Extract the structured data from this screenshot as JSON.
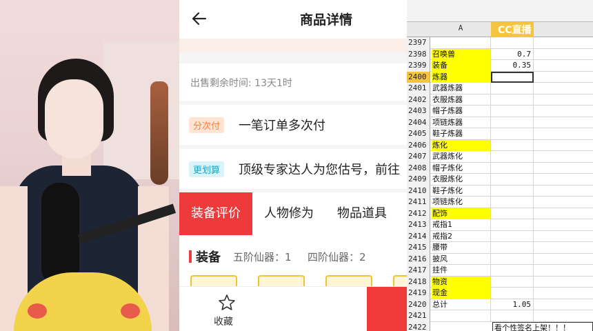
{
  "header": {
    "title": "商品详情"
  },
  "timer": {
    "text": "出售剩余时间: 13天1时"
  },
  "installment": {
    "tag": "分次付",
    "text": "一笔订单多次付"
  },
  "estimate": {
    "tag": "更划算",
    "text": "顶级专家达人为您估号，前往"
  },
  "tabs": [
    {
      "label": "装备评价",
      "active": true
    },
    {
      "label": "人物修为",
      "active": false
    },
    {
      "label": "物品道具",
      "active": false
    }
  ],
  "equipment": {
    "title": "装备",
    "stat1": "五阶仙器：1",
    "stat2": "四阶仙器：2"
  },
  "footer": {
    "favorite_label": "收藏"
  },
  "sheet": {
    "col_a_header": "A",
    "watermark": "CC直播",
    "rows": [
      {
        "num": "2397",
        "a": "",
        "b": ""
      },
      {
        "num": "2398",
        "a": "召唤兽",
        "b": "0.7"
      },
      {
        "num": "2399",
        "a": "装备",
        "b": "0.35"
      },
      {
        "num": "2400",
        "a": "炼器",
        "b": ""
      },
      {
        "num": "2401",
        "a": "武器炼器",
        "b": ""
      },
      {
        "num": "2402",
        "a": "衣服炼器",
        "b": ""
      },
      {
        "num": "2403",
        "a": "帽子炼器",
        "b": ""
      },
      {
        "num": "2404",
        "a": "项链炼器",
        "b": ""
      },
      {
        "num": "2405",
        "a": "鞋子炼器",
        "b": ""
      },
      {
        "num": "2406",
        "a": "炼化",
        "b": ""
      },
      {
        "num": "2407",
        "a": "武器炼化",
        "b": ""
      },
      {
        "num": "2408",
        "a": "帽子炼化",
        "b": ""
      },
      {
        "num": "2409",
        "a": "衣服炼化",
        "b": ""
      },
      {
        "num": "2410",
        "a": "鞋子炼化",
        "b": ""
      },
      {
        "num": "2411",
        "a": "项链炼化",
        "b": ""
      },
      {
        "num": "2412",
        "a": "配饰",
        "b": ""
      },
      {
        "num": "2413",
        "a": "戒指1",
        "b": ""
      },
      {
        "num": "2414",
        "a": "戒指2",
        "b": ""
      },
      {
        "num": "2415",
        "a": "腰带",
        "b": ""
      },
      {
        "num": "2416",
        "a": "披风",
        "b": ""
      },
      {
        "num": "2417",
        "a": "挂件",
        "b": ""
      },
      {
        "num": "2418",
        "a": "物资",
        "b": ""
      },
      {
        "num": "2419",
        "a": "现金",
        "b": ""
      },
      {
        "num": "2420",
        "a": "总计",
        "b": "1.05"
      },
      {
        "num": "2421",
        "a": "",
        "b": ""
      },
      {
        "num": "2422",
        "a": "",
        "b": ""
      }
    ],
    "note": "看个性签名上架！！！",
    "highlight_color": "#ffff00"
  }
}
